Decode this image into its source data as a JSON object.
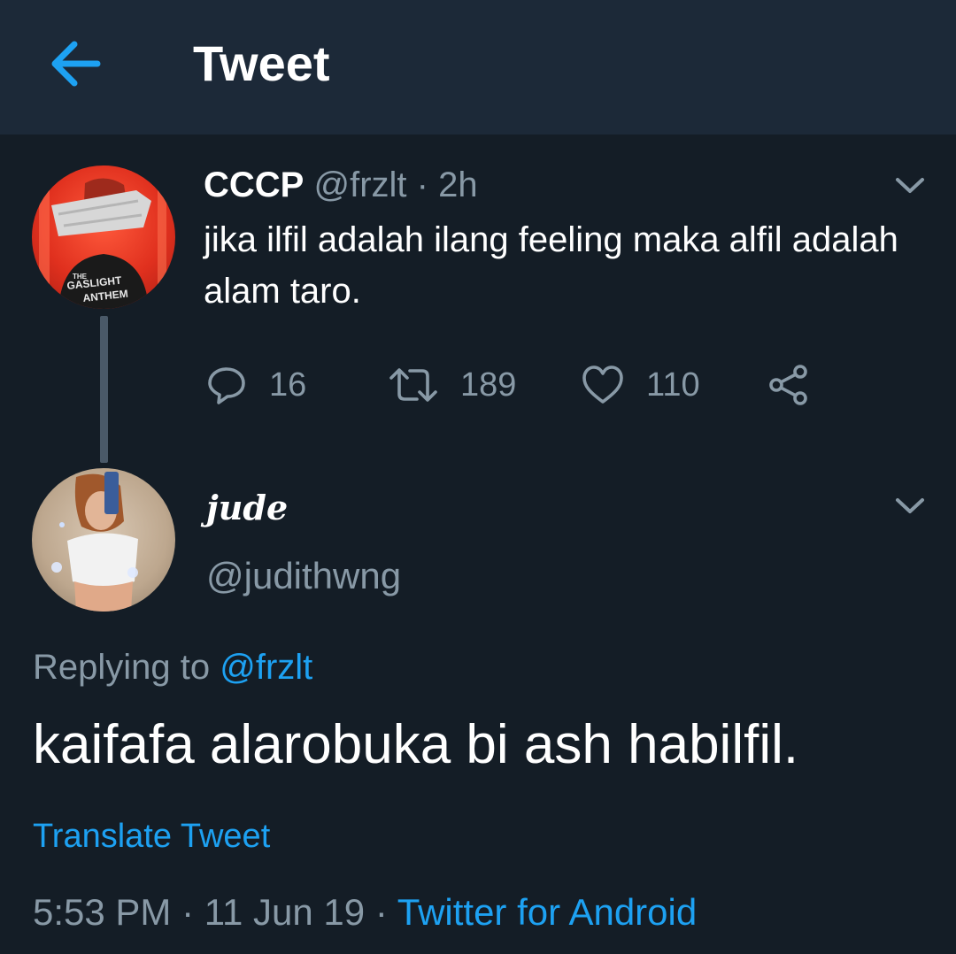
{
  "header": {
    "title": "Tweet"
  },
  "original_tweet": {
    "display_name": "CCCP",
    "handle": "@frzlt",
    "separator": "·",
    "time": "2h",
    "text": "jika ilfil adalah ilang feeling maka alfil adalah alam taro.",
    "avatar_text": "THE GASLIGHT ANTHEM",
    "stats": {
      "replies": "16",
      "retweets": "189",
      "likes": "110"
    }
  },
  "reply_tweet": {
    "display_name": "jude",
    "handle": "@judithwng",
    "replying_to_label": "Replying to",
    "replying_to_handle": "@frzlt",
    "text": "kaifafa alarobuka bi ash habilfil.",
    "translate_label": "Translate Tweet",
    "time": "5:53 PM",
    "date": "11 Jun 19",
    "separator": "·",
    "source": "Twitter for Android"
  },
  "colors": {
    "background": "#141d26",
    "header_background": "#1c2938",
    "accent": "#1da1f2",
    "muted_text": "#8899a6"
  },
  "icons": {
    "back": "arrow-left-icon",
    "caret": "chevron-down-icon",
    "reply": "speech-bubble-icon",
    "retweet": "retweet-icon",
    "like": "heart-icon",
    "share": "share-icon"
  }
}
